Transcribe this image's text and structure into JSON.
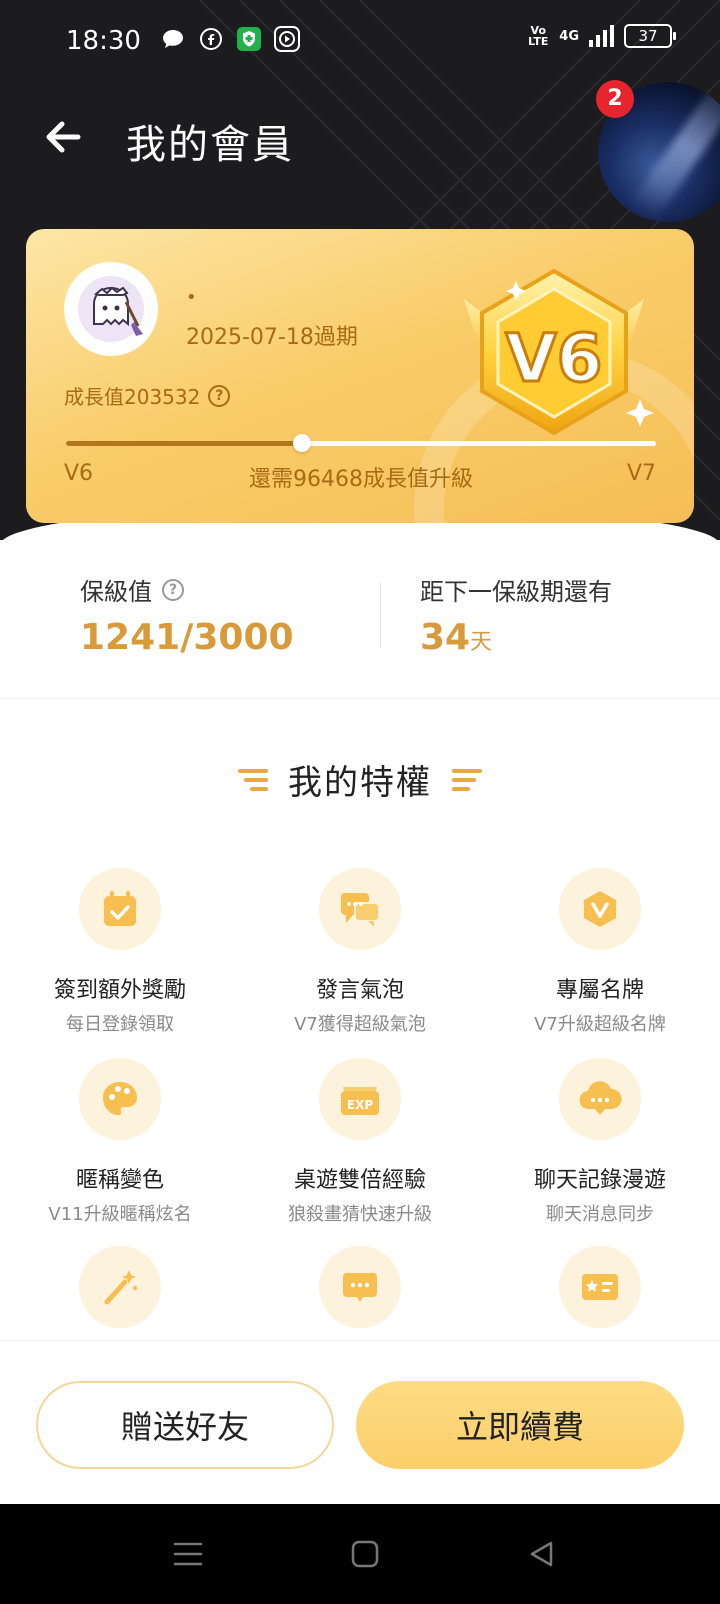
{
  "status_bar": {
    "time": "18:30",
    "volte": "Vo LTE",
    "network": "4G",
    "battery": "37",
    "app_icons": [
      "chat-bubble-icon",
      "facebook-icon",
      "vpn-shield-icon",
      "media-play-icon"
    ]
  },
  "header": {
    "title": "我的會員",
    "notification_count": "2"
  },
  "card": {
    "name_dot": "•",
    "expiry": "2025-07-18過期",
    "growth_label": "成長值203532",
    "current_level": "V6",
    "next_level": "V7",
    "upgrade_hint": "還需96468成長值升級",
    "progress": 0.4,
    "badge_text": "V6"
  },
  "stats": {
    "keep_label": "保級值",
    "keep_value": "1241/3000",
    "days_label": "距下一保級期還有",
    "days_value": "34",
    "days_unit": "天"
  },
  "privileges": {
    "title": "我的特權",
    "items": [
      {
        "name": "簽到額外獎勵",
        "sub": "每日登錄領取",
        "icon": "calendar-check-icon"
      },
      {
        "name": "發言氣泡",
        "sub": "V7獲得超級氣泡",
        "icon": "chat-bubbles-icon"
      },
      {
        "name": "專屬名牌",
        "sub": "V7升級超級名牌",
        "icon": "v-shield-icon"
      },
      {
        "name": "暱稱變色",
        "sub": "V11升級暱稱炫名",
        "icon": "palette-icon"
      },
      {
        "name": "桌遊雙倍經驗",
        "sub": "狼殺畫猜快速升級",
        "icon": "exp-ticket-icon"
      },
      {
        "name": "聊天記錄漫遊",
        "sub": "聊天消息同步",
        "icon": "cloud-chat-icon"
      },
      {
        "name": "",
        "sub": "",
        "icon": "magic-wand-icon"
      },
      {
        "name": "",
        "sub": "",
        "icon": "message-icon"
      },
      {
        "name": "",
        "sub": "",
        "icon": "id-card-icon"
      }
    ]
  },
  "footer": {
    "gift_label": "贈送好友",
    "renew_label": "立即續費"
  },
  "colors": {
    "accent": "#d99a3a",
    "icon": "#f6bf50",
    "card_text": "#a86a15"
  }
}
